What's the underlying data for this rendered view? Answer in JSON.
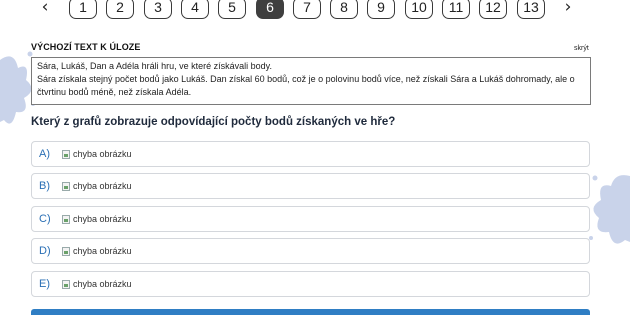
{
  "pager": {
    "prev_icon": "chevron-left-icon",
    "next_icon": "chevron-right-icon",
    "pages": [
      "1",
      "2",
      "3",
      "4",
      "5",
      "6",
      "7",
      "8",
      "9",
      "10",
      "11",
      "12",
      "13"
    ],
    "active_page": "6",
    "active_color": "#3f3f3f"
  },
  "source": {
    "label": "VÝCHOZÍ TEXT K ÚLOZE",
    "hide_link": "skrýt",
    "line1": "Sára, Lukáš, Dan a Adéla hráli hru, ve které získávali body.",
    "line2": "Sára získala stejný počet bodů jako Lukáš. Dan získal 60 bodů, což je o polovinu bodů více, než získali Sára a Lukáš dohromady, ale o čtvrtinu bodů méně, než získala Adéla."
  },
  "question": "Který z grafů zobrazuje odpovídající počty bodů získaných ve hře?",
  "options": [
    {
      "letter": "A)",
      "alt": "chyba obrázku"
    },
    {
      "letter": "B)",
      "alt": "chyba obrázku"
    },
    {
      "letter": "C)",
      "alt": "chyba obrázku"
    },
    {
      "letter": "D)",
      "alt": "chyba obrázku"
    },
    {
      "letter": "E)",
      "alt": "chyba obrázku"
    }
  ],
  "colors": {
    "accent": "#2a6fb5",
    "submit_bar": "#2f7ec4",
    "splash": "#c9d3ea"
  }
}
